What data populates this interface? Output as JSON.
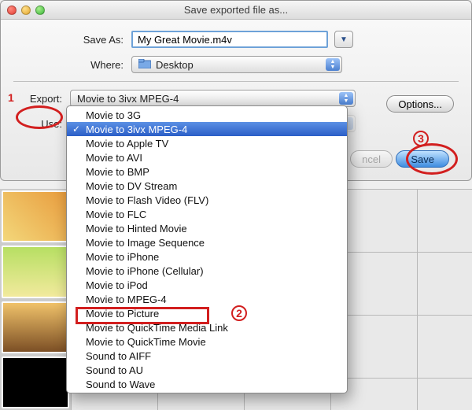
{
  "window": {
    "title": "Save exported file as..."
  },
  "labels": {
    "save_as": "Save As:",
    "where": "Where:",
    "export": "Export:",
    "use": "Use:"
  },
  "fields": {
    "filename": "My Great Movie.m4v",
    "where_selected": "Desktop",
    "where_icon_name": "desktop-folder",
    "export_selected": "Movie to 3ivx MPEG-4",
    "use_selected": ""
  },
  "buttons": {
    "options": "Options...",
    "cancel": "ncel",
    "save": "Save"
  },
  "export_menu": [
    "Movie to 3G",
    "Movie to 3ivx MPEG-4",
    "Movie to Apple TV",
    "Movie to AVI",
    "Movie to BMP",
    "Movie to DV Stream",
    "Movie to Flash Video (FLV)",
    "Movie to FLC",
    "Movie to Hinted Movie",
    "Movie to Image Sequence",
    "Movie to iPhone",
    "Movie to iPhone (Cellular)",
    "Movie to iPod",
    "Movie to MPEG-4",
    "Movie to Picture",
    "Movie to QuickTime Media Link",
    "Movie to QuickTime Movie",
    "Sound to AIFF",
    "Sound to AU",
    "Sound to Wave"
  ],
  "selected_export_index": 1,
  "annotations": {
    "step1": "1",
    "step1_target": "export-label",
    "step2": "2",
    "step2_target": "menu-item-movie-to-mpeg-4",
    "step3": "3",
    "step3_target": "save-button"
  }
}
